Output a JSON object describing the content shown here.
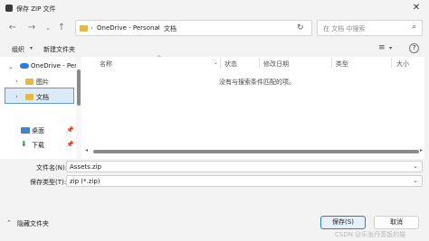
{
  "window": {
    "title": "保存 ZIP 文件",
    "close_icon": "close-icon"
  },
  "nav": {
    "back_icon": "back-arrow-icon",
    "forward_icon": "forward-arrow-icon",
    "dropdown_icon": "chevron-down-icon",
    "up_icon": "up-arrow-icon",
    "breadcrumb": [
      "OneDrive - Personal",
      "文档"
    ],
    "separator": "›",
    "refresh_icon": "refresh-icon",
    "search_placeholder": "在 文档 中搜索",
    "search_icon": "search-icon"
  },
  "toolbar": {
    "organize": "组织",
    "new_folder": "新建文件夹",
    "view_icon": "view-list-icon",
    "help_icon": "help-icon"
  },
  "sidebar": {
    "items": [
      {
        "label": "OneDrive - Per",
        "icon": "cloud-icon"
      },
      {
        "label": "图片",
        "icon": "folder-icon"
      },
      {
        "label": "文档",
        "icon": "folder-icon",
        "selected": true
      },
      {
        "label": "桌面",
        "icon": "desktop-icon",
        "pinned": true
      },
      {
        "label": "下载",
        "icon": "download-icon",
        "pinned": true
      }
    ]
  },
  "columns": [
    "名称",
    "状态",
    "修改日期",
    "类型",
    "大小"
  ],
  "empty_message": "没有与搜索条件匹配的项。",
  "form": {
    "filename_label": "文件名(N):",
    "filename_value": "Assets.zip",
    "filetype_label": "保存类型(T):",
    "filetype_value": "zip (*.zip)"
  },
  "footer": {
    "hide_folders": "隐藏文件夹",
    "save": "保存(S)",
    "cancel": "取消"
  },
  "watermark": "CSDN @乐张丹蒸饭的猫",
  "colors": {
    "accent": "#2f7ad6",
    "folder": "#e6b84a",
    "selection": "#dce9f7"
  }
}
